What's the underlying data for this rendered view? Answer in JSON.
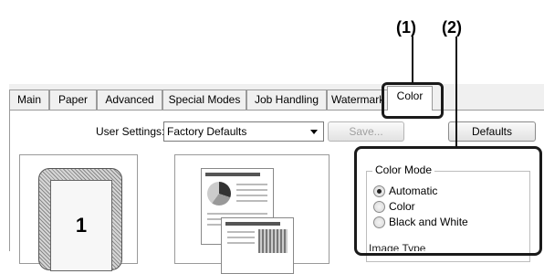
{
  "callouts": {
    "label_1": "(1)",
    "label_2": "(2)"
  },
  "tabs": [
    {
      "label": "Main"
    },
    {
      "label": "Paper"
    },
    {
      "label": "Advanced"
    },
    {
      "label": "Special Modes"
    },
    {
      "label": "Job Handling"
    },
    {
      "label": "Watermark"
    },
    {
      "label": "Color",
      "active": true
    }
  ],
  "user_settings": {
    "label": "User Settings:",
    "selected": "Factory Defaults",
    "save_label": "Save...",
    "defaults_label": "Defaults"
  },
  "preview": {
    "page_number": "1"
  },
  "color_mode": {
    "title": "Color Mode",
    "options": [
      {
        "label": "Automatic",
        "selected": true
      },
      {
        "label": "Color",
        "selected": false
      },
      {
        "label": "Black and White",
        "selected": false
      }
    ]
  },
  "image_type": {
    "label": "Image Type"
  }
}
